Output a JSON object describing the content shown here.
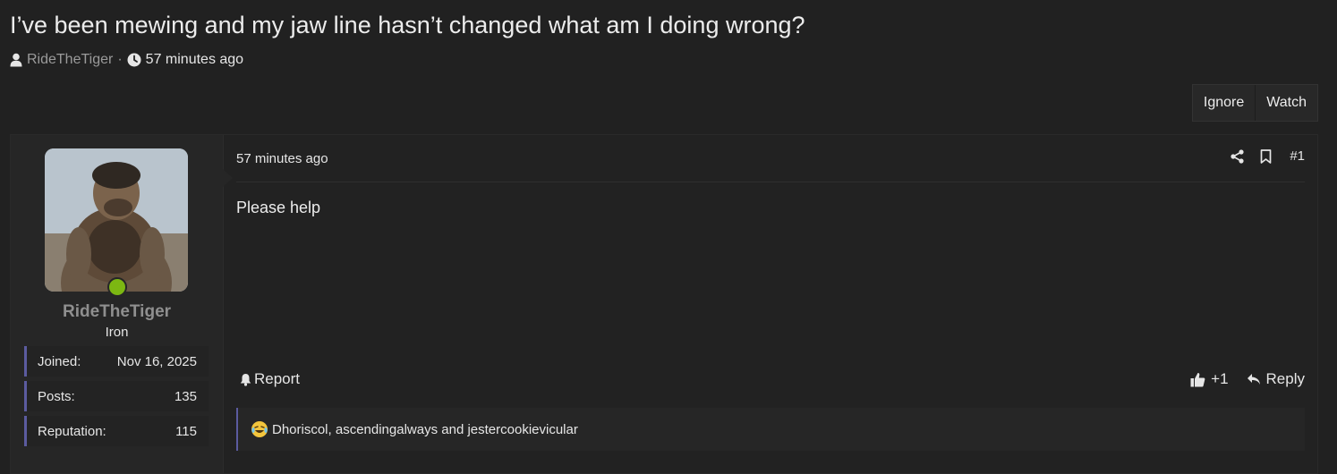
{
  "thread": {
    "title": "I’ve been mewing and my jaw line hasn’t changed what am I doing wrong?",
    "author": "RideTheTiger",
    "separator": "·",
    "time": "57 minutes ago",
    "icons": [
      "user-icon",
      "clock-icon"
    ]
  },
  "actions": {
    "ignore_label": "Ignore",
    "watch_label": "Watch"
  },
  "user": {
    "name": "RideTheTiger",
    "rank": "Iron",
    "online": true,
    "online_color": "#7cb712",
    "stats": [
      {
        "label": "Joined:",
        "value": "Nov 16, 2025"
      },
      {
        "label": "Posts:",
        "value": "135"
      },
      {
        "label": "Reputation:",
        "value": "115"
      }
    ]
  },
  "post": {
    "time": "57 minutes ago",
    "number": "#1",
    "text": "Please help",
    "report_label": "Report",
    "like_label": "+1",
    "reply_label": "Reply",
    "reactions_text": "Dhoriscol, ascendingalways and jestercookievicular",
    "reaction_emoji": "laughing-crying-icon",
    "accent_color": "#5b5b9f"
  }
}
